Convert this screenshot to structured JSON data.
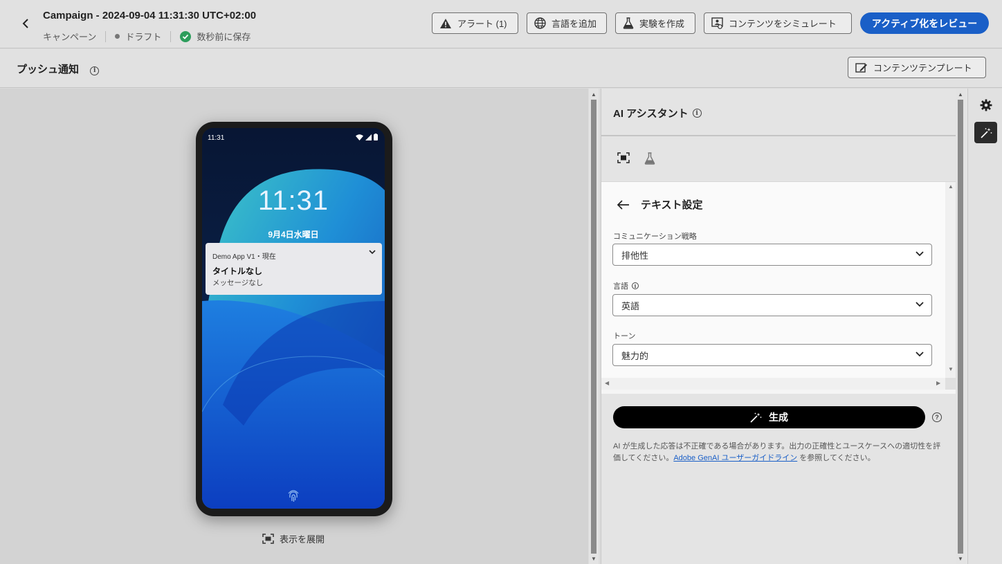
{
  "header": {
    "title": "Campaign - 2024-09-04 11:31:30 UTC+02:00",
    "type_label": "キャンペーン",
    "status_label": "ドラフト",
    "saved_label": "数秒前に保存",
    "buttons": {
      "alert": "アラート (1)",
      "add_language": "言語を追加",
      "create_experiment": "実験を作成",
      "simulate_content": "コンテンツをシミュレート",
      "review_activate": "アクティブ化をレビュー"
    }
  },
  "subheader": {
    "title": "プッシュ通知",
    "content_template": "コンテンツテンプレート"
  },
  "preview": {
    "status_time": "11:31",
    "lock_time": "11:31",
    "lock_date": "9月4日水曜日",
    "notification": {
      "app": "Demo App V1・現在",
      "title": "タイトルなし",
      "message": "メッセージなし"
    },
    "expand_label": "表示を展開"
  },
  "ai_assistant": {
    "title": "AI アシスタント",
    "settings": {
      "heading": "テキスト設定",
      "fields": [
        {
          "label": "コミュニケーション戦略",
          "value": "排他性"
        },
        {
          "label": "言語",
          "value": "英語"
        },
        {
          "label": "トーン",
          "value": "魅力的"
        }
      ]
    },
    "generate_label": "生成",
    "disclaimer_text": "AI が生成した応答は不正確である場合があります。出力の正確性とユースケースへの適切性を評価してください。",
    "disclaimer_link": "Adobe GenAI ユーザーガイドライン",
    "disclaimer_suffix": " を参照してください。"
  },
  "colors": {
    "accent": "#1a5fc7",
    "saved_check": "#2d9d5c",
    "generate_button": "#000000"
  }
}
